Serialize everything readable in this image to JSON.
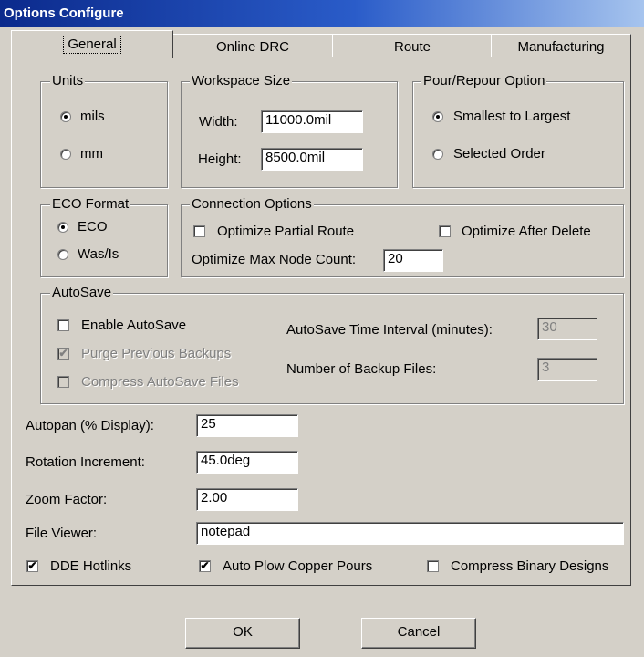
{
  "window": {
    "title": "Options Configure"
  },
  "tabs": [
    {
      "label": "General",
      "active": true
    },
    {
      "label": "Online DRC"
    },
    {
      "label": "Route"
    },
    {
      "label": "Manufacturing"
    }
  ],
  "units": {
    "legend": "Units",
    "mils": "mils",
    "mm": "mm",
    "selected": "mils"
  },
  "workspace": {
    "legend": "Workspace Size",
    "width_label": "Width:",
    "width_value": "11000.0mil",
    "height_label": "Height:",
    "height_value": "8500.0mil"
  },
  "pour": {
    "legend": "Pour/Repour Option",
    "smallest": "Smallest to Largest",
    "selected_order": "Selected Order",
    "selected": "Smallest to Largest"
  },
  "eco": {
    "legend": "ECO Format",
    "eco": "ECO",
    "wasis": "Was/Is",
    "selected": "ECO"
  },
  "connection": {
    "legend": "Connection Options",
    "optimize_partial": "Optimize Partial Route",
    "optimize_after_delete": "Optimize After Delete",
    "max_node_label": "Optimize Max Node Count:",
    "max_node_value": "20"
  },
  "autosave": {
    "legend": "AutoSave",
    "enable": "Enable AutoSave",
    "purge": "Purge Previous Backups",
    "compress": "Compress AutoSave Files",
    "interval_label": "AutoSave Time Interval (minutes):",
    "interval_value": "30",
    "backup_label": "Number of Backup Files:",
    "backup_value": "3"
  },
  "fields": {
    "autopan_label": "Autopan (% Display):",
    "autopan_value": "25",
    "rotation_label": "Rotation Increment:",
    "rotation_value": "45.0deg",
    "zoom_label": "Zoom Factor:",
    "zoom_value": "2.00",
    "viewer_label": "File Viewer:",
    "viewer_value": "notepad"
  },
  "bottom_checks": {
    "dde": "DDE Hotlinks",
    "auto_plow": "Auto Plow Copper Pours",
    "compress_binary": "Compress Binary Designs"
  },
  "buttons": {
    "ok": "OK",
    "cancel": "Cancel"
  }
}
